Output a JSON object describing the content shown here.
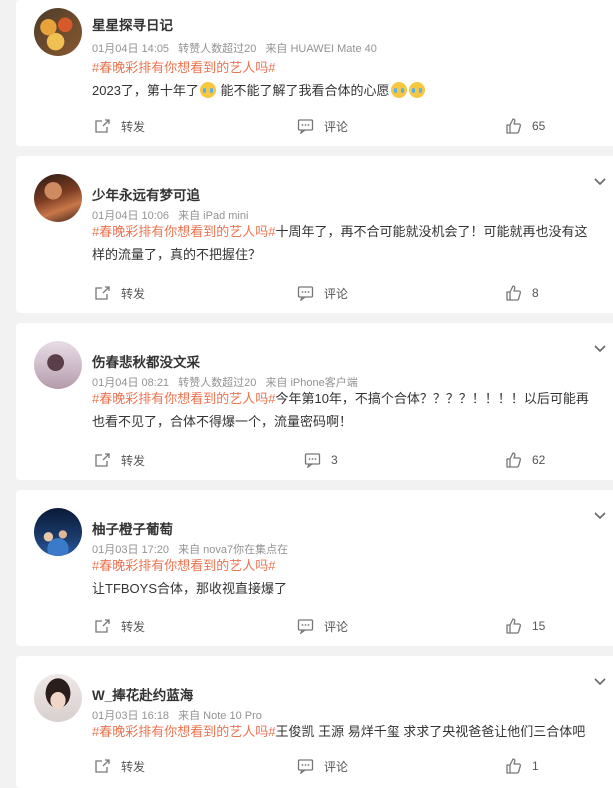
{
  "labels": {
    "repost": "转发",
    "comment": "评论"
  },
  "posts": [
    {
      "username": "星星探寻日记",
      "date": "01月04日 14:05",
      "extra": "转赞人数超过20",
      "source": "来自 HUAWEI Mate 40",
      "tag": "#春晚彩排有你想看到的艺人吗#",
      "text_a": "2023了，第十年了",
      "text_b": "能不能了解了我看合体的心愿",
      "comment_count": "",
      "likes": "65"
    },
    {
      "username": "少年永远有梦可追",
      "date": "01月04日 10:06",
      "source": "来自 iPad mini",
      "tag": "#春晚彩排有你想看到的艺人吗#",
      "text": "十周年了，再不合可能就没机会了！可能就再也没有这",
      "text2": "样的流量了，真的不把握住？",
      "likes": "8"
    },
    {
      "username": "伤春悲秋都没文采",
      "date": "01月04日 08:21",
      "extra": "转赞人数超过20",
      "source": "来自 iPhone客户端",
      "tag": "#春晚彩排有你想看到的艺人吗#",
      "text": "今年第10年，不搞个合体？？？？！！！！以后可能再",
      "text2": "也看不见了，合体不得爆一个，流量密码啊！",
      "comment_count": "3",
      "likes": "62"
    },
    {
      "username": "柚子橙子葡萄",
      "date": "01月03日 17:20",
      "source": "来自 nova7你在集点在",
      "tag": "#春晚彩排有你想看到的艺人吗#",
      "text": "让TFBOYS合体，那收视直接爆了",
      "likes": "15"
    },
    {
      "username": "W_捧花赴约蓝海",
      "date": "01月03日 16:18",
      "source": "来自 Note 10 Pro",
      "tag": "#春晚彩排有你想看到的艺人吗#",
      "text": "王俊凯 王源 易烊千玺 求求了央视爸爸让他们三合体吧",
      "likes": "1"
    }
  ],
  "colors": {
    "tag": "#eb7350",
    "meta": "#939393",
    "bg": "#f2f2f2"
  },
  "icons": [
    "repost-icon",
    "comment-icon",
    "like-icon",
    "chevron-down-icon"
  ]
}
